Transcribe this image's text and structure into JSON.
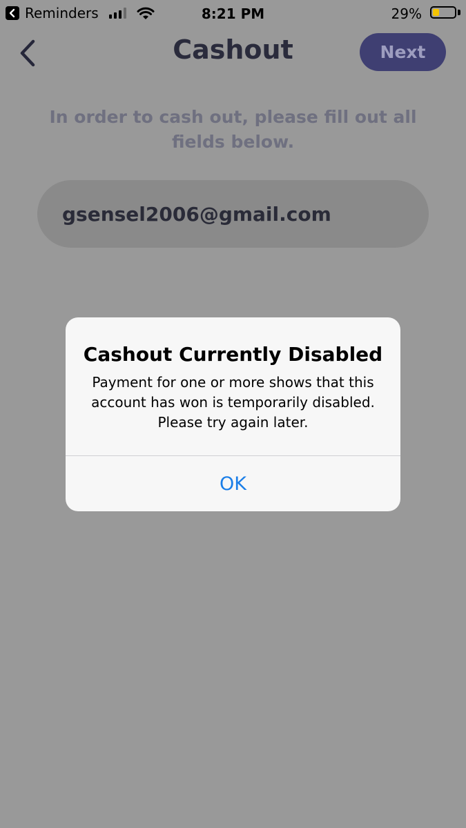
{
  "status_bar": {
    "back_app": "Reminders",
    "time": "8:21 PM",
    "battery_percent": "29%",
    "battery_level": 0.29,
    "signal_bars": 4,
    "signal_bars_active": 3
  },
  "nav": {
    "title": "Cashout",
    "next_label": "Next",
    "back_icon": "chevron-left-icon"
  },
  "form": {
    "instructions": "In order to cash out, please fill out all fields below.",
    "email_value": "gsensel2006@gmail.com"
  },
  "alert": {
    "title": "Cashout Currently Disabled",
    "message": "Payment for one or more shows that this account has won is temporarily disabled. Please try again later.",
    "ok_label": "OK"
  },
  "colors": {
    "overlay_background": "#999999",
    "next_button": "#3f3f72",
    "alert_button": "#1a7ee8",
    "battery_fill": "#f5c400"
  }
}
